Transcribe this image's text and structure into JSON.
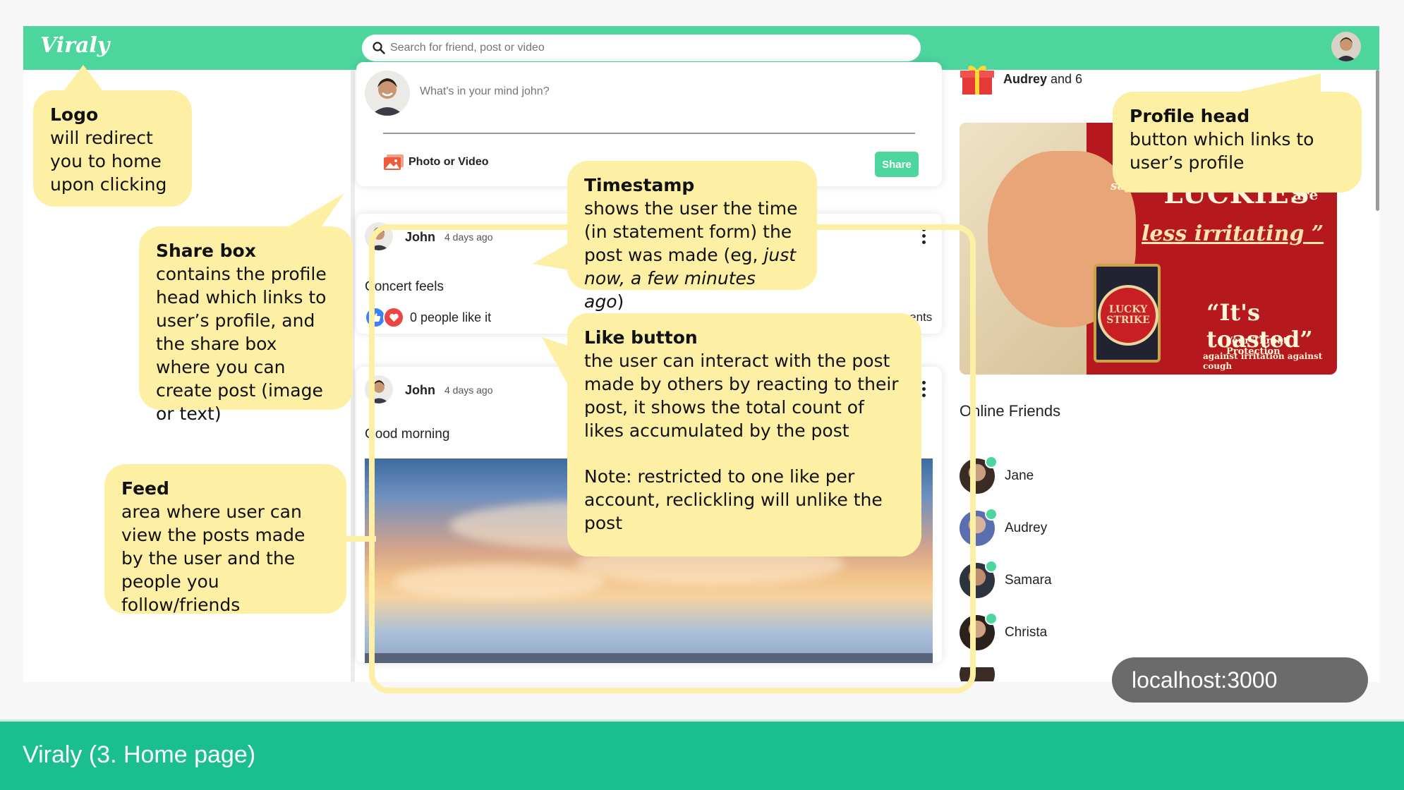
{
  "app": {
    "logo": "Viraly",
    "search_placeholder": "Search for friend, post or video"
  },
  "share_box": {
    "placeholder": "What's in your mind john?",
    "photo_video_label": "Photo or Video",
    "share_label": "Share"
  },
  "posts": [
    {
      "author": "John",
      "time": "4 days ago",
      "text": "Concert feels",
      "likes_text": "0 people like it",
      "comments_text": "ments"
    },
    {
      "author": "John",
      "time": "4 days ago",
      "text": "Good morning"
    }
  ],
  "birthday": {
    "name": "Audrey",
    "rest": " and 6"
  },
  "ad": {
    "say": "say",
    "luckies": "“LUCKIES",
    "are": "are",
    "irritating": "less irritating ”",
    "lucky": "LUCKY",
    "strike": "STRIKE",
    "toasted": "“It's toasted”",
    "protection": "Your Throat Protection",
    "cough": "against irritation against cough"
  },
  "online_friends": {
    "title": "Online Friends",
    "friends": [
      "Jane",
      "Audrey",
      "Samara",
      "Christa"
    ]
  },
  "annotations": {
    "logo": {
      "title": "Logo",
      "desc": "will redirect you to home upon clicking"
    },
    "share_box": {
      "title": "Share box",
      "desc": "contains the profile head which links to user’s profile, and the share box where you can create post (image or text)"
    },
    "feed": {
      "title": "Feed",
      "desc": "area where user can view the posts made by the user and  the people you follow/friends"
    },
    "timestamp": {
      "title": "Timestamp",
      "desc": "shows the user the time (in statement form) the post was made (eg, ",
      "examples": "just now, a few minutes ago"
    },
    "like_button": {
      "title": "Like button",
      "desc": "the user can interact with the post made by others by reacting to their post, it shows the total count of likes accumulated by the post",
      "note": "Note: restricted to one like per account, reclickling will unlike the post"
    },
    "profile_head": {
      "title": "Profile head",
      "desc": "button which links to user’s profile"
    }
  },
  "footer": {
    "slide_title": "Viraly (3. Home page)",
    "url_pill": "localhost:3000"
  },
  "colors": {
    "brand": "#4cd59c",
    "callout": "#fdf0a4",
    "footer": "#1bbf8f"
  },
  "icons": [
    "search-icon",
    "photo-icon",
    "like-icon",
    "heart-icon",
    "gift-icon",
    "more-icon"
  ]
}
